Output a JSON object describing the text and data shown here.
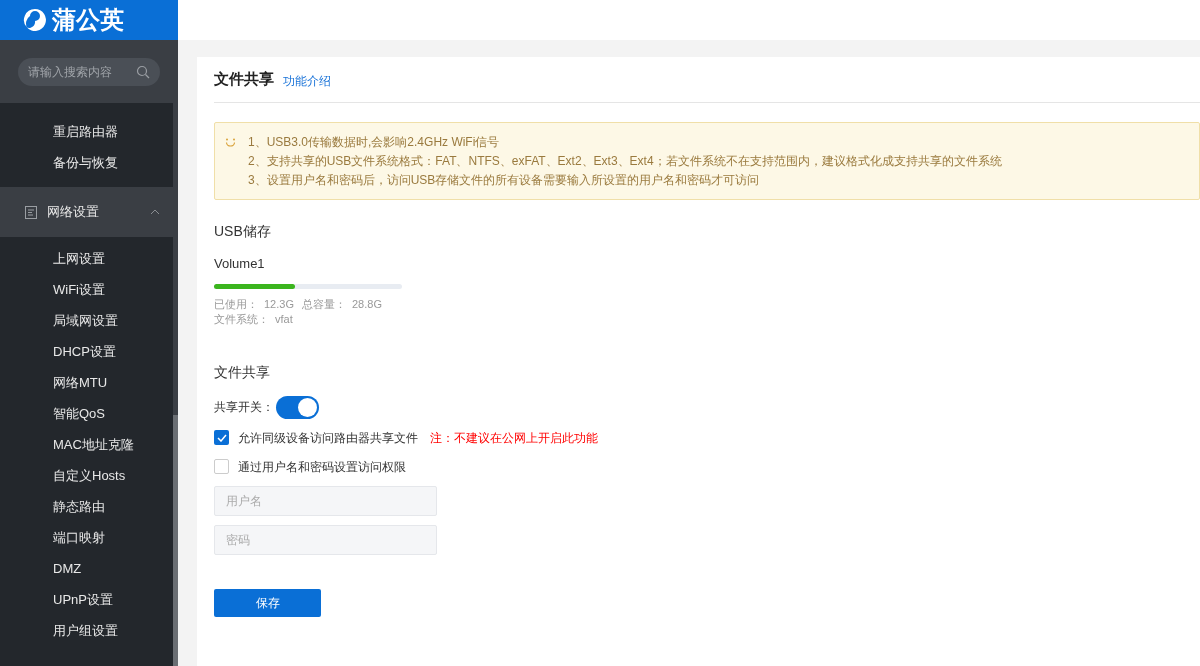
{
  "logo": {
    "text": "蒲公英"
  },
  "search": {
    "placeholder": "请输入搜索内容"
  },
  "sidebar": {
    "items_above": [
      {
        "label": "重启路由器",
        "selected": false
      },
      {
        "label": "备份与恢复",
        "selected": false
      }
    ],
    "group": {
      "label": "网络设置",
      "expanded": true,
      "children": [
        {
          "label": "上网设置",
          "selected": false
        },
        {
          "label": "WiFi设置",
          "selected": false
        },
        {
          "label": "局域网设置",
          "selected": false
        },
        {
          "label": "DHCP设置",
          "selected": false
        },
        {
          "label": "网络MTU",
          "selected": false
        },
        {
          "label": "智能QoS",
          "selected": false
        },
        {
          "label": "MAC地址克隆",
          "selected": false
        },
        {
          "label": "自定义Hosts",
          "selected": false
        },
        {
          "label": "静态路由",
          "selected": false
        },
        {
          "label": "端口映射",
          "selected": false
        },
        {
          "label": "DMZ",
          "selected": false
        },
        {
          "label": "UPnP设置",
          "selected": false
        },
        {
          "label": "用户组设置",
          "selected": false
        }
      ]
    }
  },
  "page": {
    "title": "文件共享",
    "intro_link": "功能介绍",
    "notice": [
      "1、USB3.0传输数据时,会影响2.4GHz WiFi信号",
      "2、支持共享的USB文件系统格式：FAT、NTFS、exFAT、Ext2、Ext3、Ext4；若文件系统不在支持范围内，建议格式化成支持共享的文件系统",
      "3、设置用户名和密码后，访问USB存储文件的所有设备需要输入所设置的用户名和密码才可访问"
    ],
    "usb": {
      "heading": "USB储存",
      "volume": "Volume1",
      "level": 0.43,
      "used_label": "已使用：",
      "used": "12.3G",
      "total_label": "总容量：",
      "total": "28.8G",
      "fs_label": "文件系统：",
      "fs": "vfat"
    },
    "sharing": {
      "heading": "文件共享",
      "switch_label": "共享开关：",
      "on": true,
      "options": [
        {
          "label": "允许同级设备访问路由器共享文件",
          "checked": true,
          "note": "注：不建议在公网上开启此功能"
        },
        {
          "label": "通过用户名和密码设置访问权限",
          "checked": false
        }
      ],
      "fields": [
        {
          "placeholder": "用户名"
        },
        {
          "placeholder": "密码"
        }
      ],
      "save": "保存"
    }
  }
}
